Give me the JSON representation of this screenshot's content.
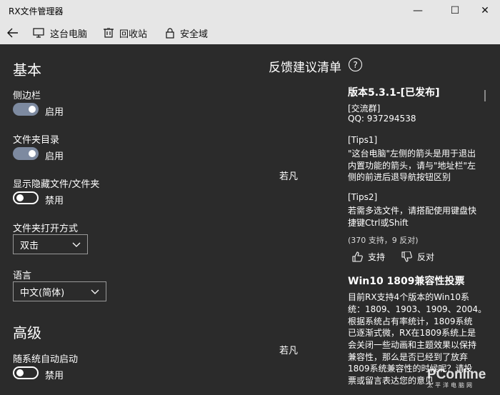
{
  "window": {
    "title": "RX文件管理器",
    "minimize_glyph": "—",
    "maximize_glyph": "☐",
    "close_glyph": "✕"
  },
  "toolbar": {
    "back_icon": "arrow-left-icon",
    "items": [
      {
        "label": "这台电脑",
        "icon": "monitor-icon"
      },
      {
        "label": "回收站",
        "icon": "recycle-bin-icon"
      },
      {
        "label": "安全域",
        "icon": "lock-icon"
      }
    ],
    "settings_icon": "gear-icon"
  },
  "settings": {
    "basic_title": "基本",
    "sidebar": {
      "label": "侧边栏",
      "state": "启用",
      "on": true
    },
    "folder_tree": {
      "label": "文件夹目录",
      "state": "启用",
      "on": true
    },
    "hidden_files": {
      "label": "显示隐藏文件/文件夹",
      "state": "禁用",
      "on": false
    },
    "open_mode": {
      "label": "文件夹打开方式",
      "value": "双击"
    },
    "language": {
      "label": "语言",
      "value": "中文(简体)"
    },
    "advanced_title": "高级",
    "auto_start": {
      "label": "随系统自动启动",
      "state": "禁用",
      "on": false
    }
  },
  "feedback": {
    "title": "反馈建议清单",
    "help_glyph": "?",
    "posts": [
      {
        "author": "若凡",
        "title": "版本5.3.1-[已发布]",
        "lines": [
          "[交流群]",
          "QQ: 937294538",
          "[Tips1]",
          "\"这台电脑\"左侧的箭头是用于退出",
          "内置功能的箭头，请与\"地址栏\"左",
          "侧的前进后退导航按钮区别",
          "[Tips2]",
          "若需多选文件，请搭配使用键盘快",
          "捷键Ctrl或Shift"
        ],
        "stats": "(370 支持，9 反对)",
        "support_label": "支持",
        "oppose_label": "反对"
      },
      {
        "author": "若凡",
        "title": "Win10 1809兼容性投票",
        "lines": [
          "目前RX支持4个版本的Win10系",
          "统：1809、1903、1909、2004。",
          "根据系统占有率统计，1809系统",
          "已逐渐式微，RX在1809系统上是",
          "会关闭一些动画和主题效果以保持",
          "兼容性，那么是否已经到了放弃",
          "1809系统兼容性的时候呢？请投",
          "票或留言表达您的意见"
        ]
      }
    ]
  },
  "watermark": {
    "main": "PConline",
    "sub": "太平洋电脑网"
  }
}
